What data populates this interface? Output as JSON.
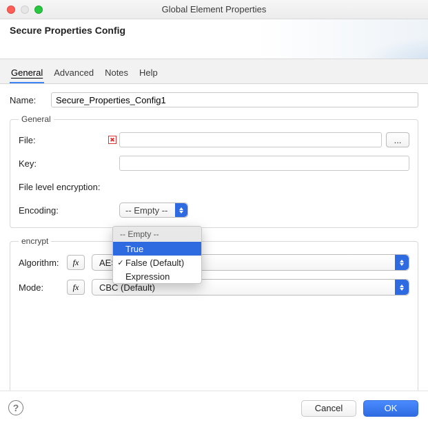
{
  "window": {
    "title": "Global Element Properties"
  },
  "header": {
    "title": "Secure Properties Config"
  },
  "tabs": [
    "General",
    "Advanced",
    "Notes",
    "Help"
  ],
  "activeTab": 0,
  "form": {
    "nameLabel": "Name:",
    "nameValue": "Secure_Properties_Config1"
  },
  "general": {
    "legend": "General",
    "fileLabel": "File:",
    "fileValue": "",
    "browseLabel": "...",
    "keyLabel": "Key:",
    "keyValue": "",
    "fleLabel": "File level encryption:",
    "encodingLabel": "Encoding:",
    "encodingDisplay": "-- Empty --"
  },
  "dropdown": {
    "header": "-- Empty --",
    "items": [
      "True",
      "False (Default)",
      "Expression"
    ],
    "selectedIndex": 0,
    "checkedIndex": 1
  },
  "encrypt": {
    "legend": "encrypt",
    "algorithmLabel": "Algorithm:",
    "algorithmValue": "AES (Default)",
    "modeLabel": "Mode:",
    "modeValue": "CBC (Default)",
    "fxLabel": "fx"
  },
  "footer": {
    "cancel": "Cancel",
    "ok": "OK"
  }
}
